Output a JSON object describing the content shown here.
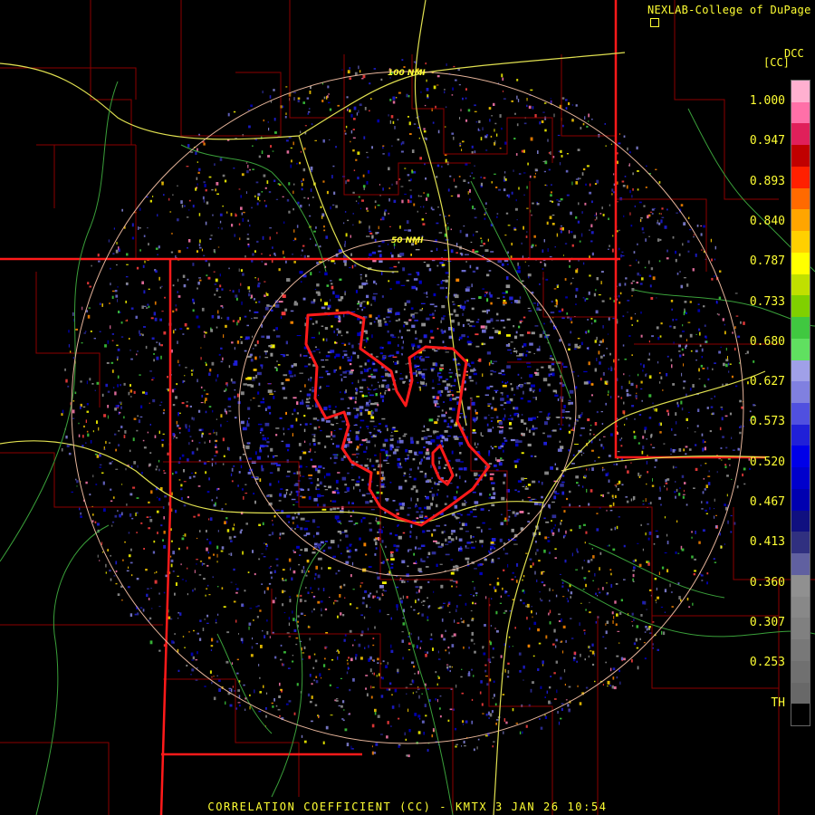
{
  "header": {
    "credit": "NEXLAB-College of DuPage",
    "credit_icon": "external-link-icon"
  },
  "legend": {
    "product_code": "DCC",
    "unit": "[CC]",
    "labels": [
      "1.000",
      "0.947",
      "0.893",
      "0.840",
      "0.787",
      "0.733",
      "0.680",
      "0.627",
      "0.573",
      "0.520",
      "0.467",
      "0.413",
      "0.360",
      "0.307",
      "0.253",
      "TH"
    ],
    "colors": [
      "#ffb0d0",
      "#ff70a8",
      "#e0205a",
      "#c00000",
      "#ff2000",
      "#ff6a00",
      "#ffa500",
      "#ffd000",
      "#ffff00",
      "#c0e000",
      "#80d000",
      "#40c840",
      "#60e060",
      "#a0a0e8",
      "#8080e0",
      "#5050e0",
      "#2020d8",
      "#0000e8",
      "#0000cc",
      "#0000b0",
      "#101080",
      "#303080",
      "#6060a0",
      "#909090",
      "#888888",
      "#808080",
      "#787878",
      "#707070",
      "#686868",
      "#000000"
    ]
  },
  "rings": [
    "100 NMI",
    "50 NMI"
  ],
  "footer": {
    "caption": "CORRELATION COEFFICIENT (CC) - KMTX 3 JAN 26 10:54"
  }
}
